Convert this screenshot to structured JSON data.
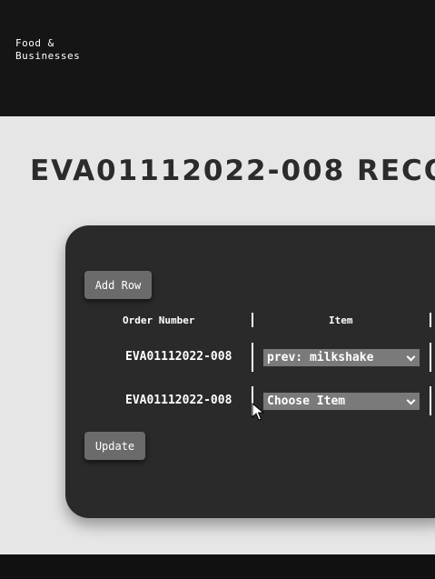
{
  "header": {
    "brand": "Food &\nBusinesses"
  },
  "page": {
    "title": "EVA01112022-008 RECO"
  },
  "table": {
    "add_row_label": "Add Row",
    "update_label": "Update",
    "columns": [
      "Order Number",
      "Item"
    ],
    "rows": [
      {
        "order_number": "EVA01112022-008",
        "item": "prev: milkshake"
      },
      {
        "order_number": "EVA01112022-008",
        "item": "Choose Item"
      }
    ]
  }
}
